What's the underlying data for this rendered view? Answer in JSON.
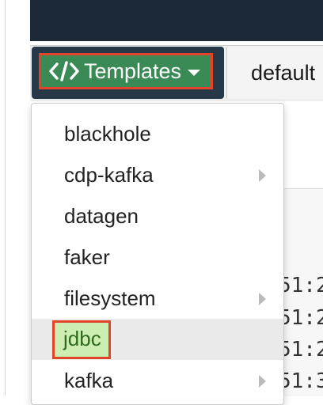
{
  "toolbar": {
    "templates_label": "Templates",
    "templates_icon": "code-icon",
    "default_label": "default"
  },
  "menu": {
    "items": [
      {
        "label": "blackhole",
        "submenu": false
      },
      {
        "label": "cdp-kafka",
        "submenu": true
      },
      {
        "label": "datagen",
        "submenu": false
      },
      {
        "label": "faker",
        "submenu": false
      },
      {
        "label": "filesystem",
        "submenu": true
      },
      {
        "label": "jdbc",
        "submenu": false,
        "selected": true
      },
      {
        "label": "kafka",
        "submenu": true
      }
    ]
  },
  "background_log": [
    "51:2",
    "51:2",
    "51:2",
    "51:3"
  ],
  "colors": {
    "top_bar": "#1b2a36",
    "templates_button": "#3a8a55",
    "highlight_outline": "#e2432a",
    "selected_item_fill": "#cdeeb2"
  }
}
